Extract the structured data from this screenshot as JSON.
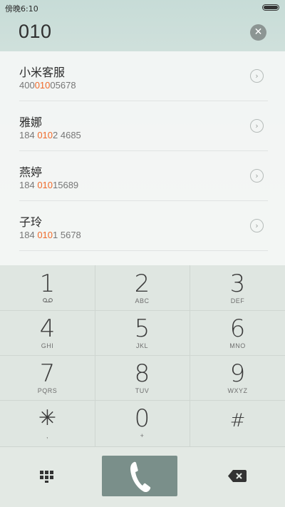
{
  "status_bar": {
    "time": "傍晚6:10"
  },
  "dialer": {
    "number": "010",
    "clear_icon": "clear-icon"
  },
  "results": [
    {
      "name": "小米客服",
      "number_parts": [
        "400",
        "010",
        "05678"
      ]
    },
    {
      "name": "雅娜",
      "number_parts": [
        "184 ",
        "010",
        "2 4685"
      ]
    },
    {
      "name": "燕婷",
      "number_parts": [
        "184 ",
        "010",
        "15689"
      ]
    },
    {
      "name": "子玲",
      "number_parts": [
        "184 ",
        "010",
        "1 5678"
      ]
    }
  ],
  "keypad": [
    {
      "digit": "1",
      "sub": "voicemail-icon"
    },
    {
      "digit": "2",
      "sub": "ABC"
    },
    {
      "digit": "3",
      "sub": "DEF"
    },
    {
      "digit": "4",
      "sub": "GHI"
    },
    {
      "digit": "5",
      "sub": "JKL"
    },
    {
      "digit": "6",
      "sub": "MNO"
    },
    {
      "digit": "7",
      "sub": "PQRS"
    },
    {
      "digit": "8",
      "sub": "TUV"
    },
    {
      "digit": "9",
      "sub": "WXYZ"
    },
    {
      "digit": "✳",
      "sub": ","
    },
    {
      "digit": "0",
      "sub": "+"
    },
    {
      "digit": "#",
      "sub": ""
    }
  ],
  "bottom_bar": {
    "keypad_icon": "keypad-icon",
    "call_icon": "phone-icon",
    "backspace_icon": "backspace-icon"
  },
  "colors": {
    "highlight": "#f06a2a",
    "call_button": "#7a8f8a"
  }
}
